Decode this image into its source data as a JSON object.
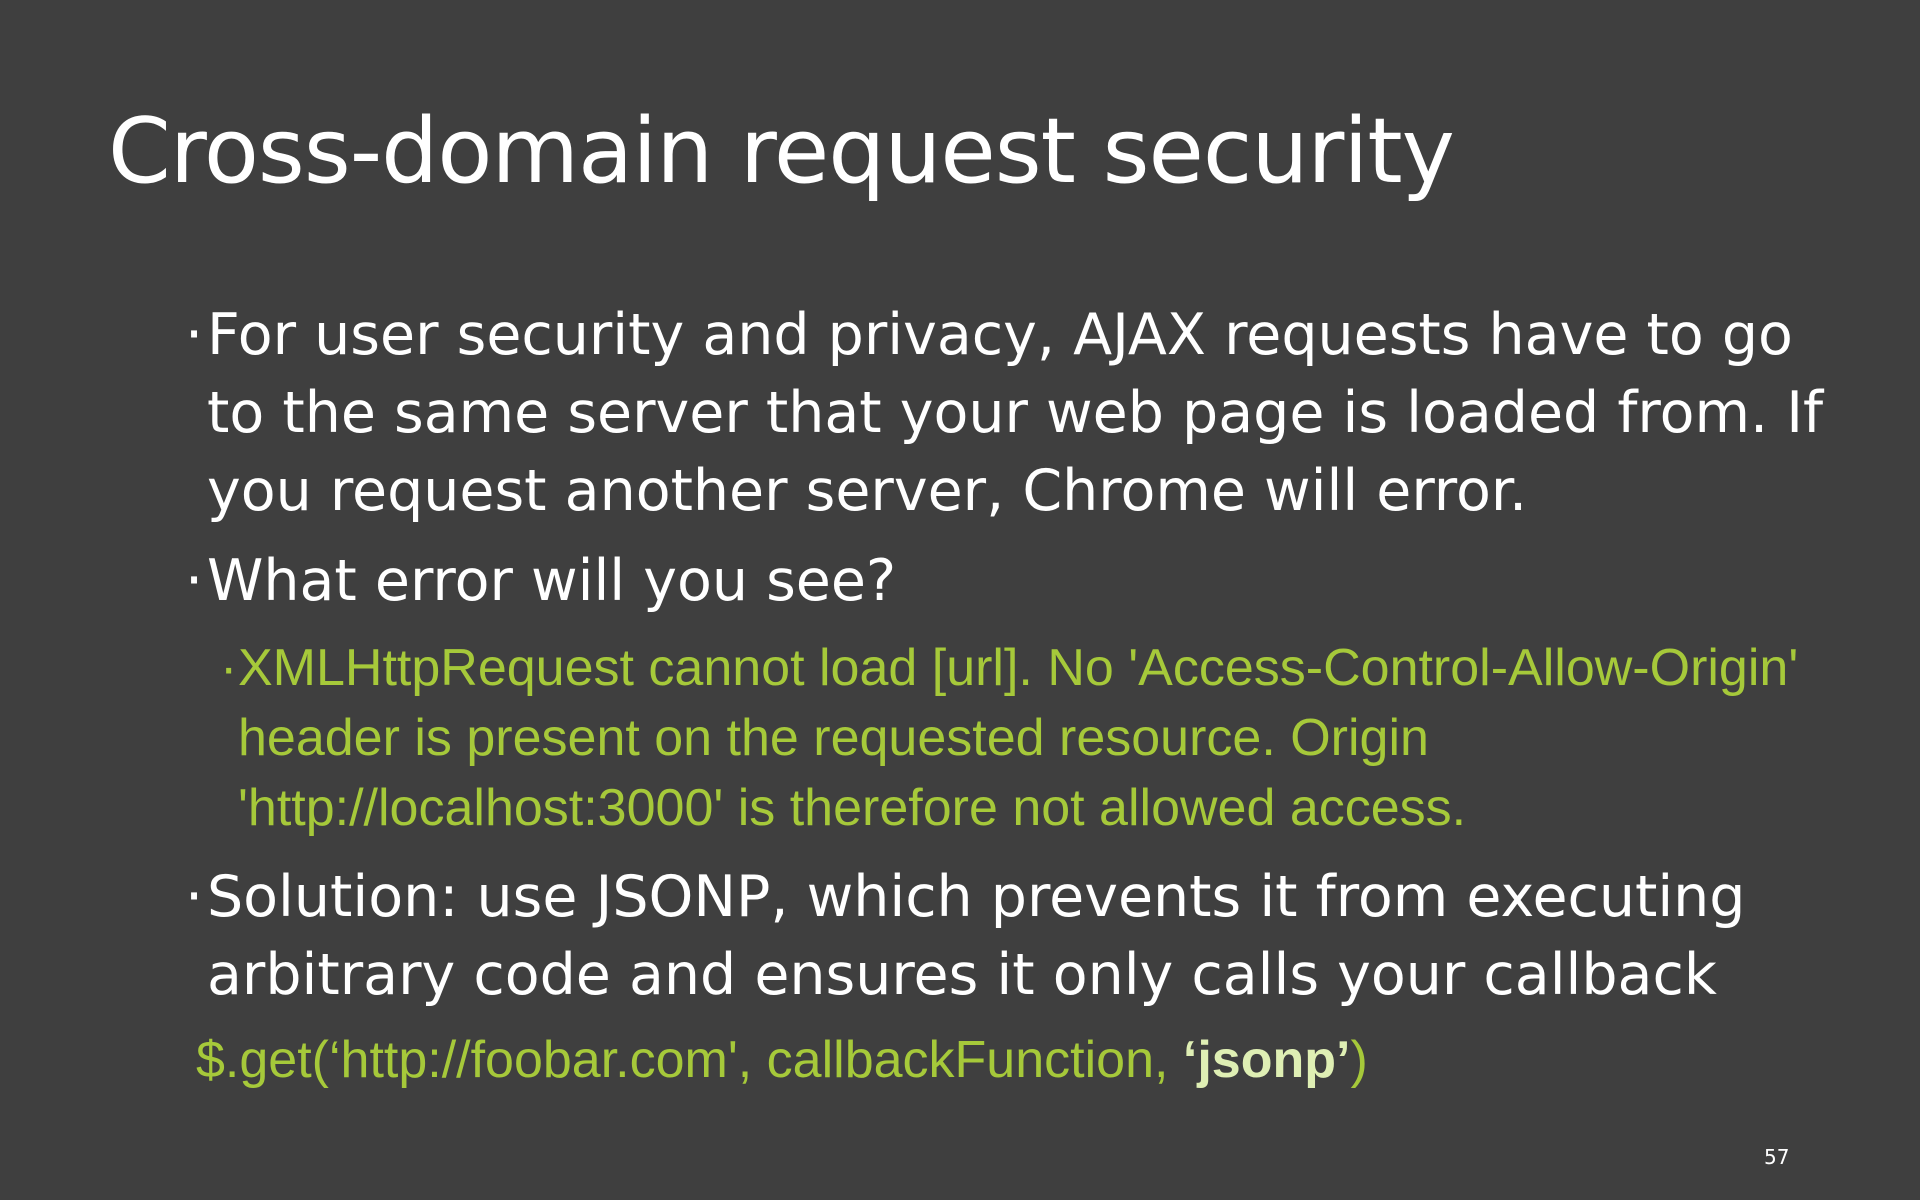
{
  "slide": {
    "title": "Cross-domain request security",
    "bullets": [
      {
        "marker": "·",
        "text": "For user security and privacy,  AJAX requests have to go to the same server that your web page is loaded from. If you request another server, Chrome will error."
      },
      {
        "marker": "·",
        "text": "What error will you see?"
      },
      {
        "marker": "·",
        "text": "XMLHttpRequest cannot load [url]. No 'Access-Control-Allow-Origin' header is present on the requested resource. Origin 'http://localhost:3000' is therefore not allowed access."
      },
      {
        "marker": "·",
        "text": "Solution: use JSONP, which prevents it from executing arbitrary code and ensures it only calls your callback"
      }
    ],
    "code": {
      "prefix": "$.get(‘http://foobar.com', callbackFunction, ",
      "strong": "‘jsonp’",
      "suffix": ")"
    },
    "page_number": "57"
  },
  "colors": {
    "background": "#3f3f3f",
    "text": "#ffffff",
    "accent_green": "#a6c93a",
    "accent_light_green": "#dfefb4"
  }
}
